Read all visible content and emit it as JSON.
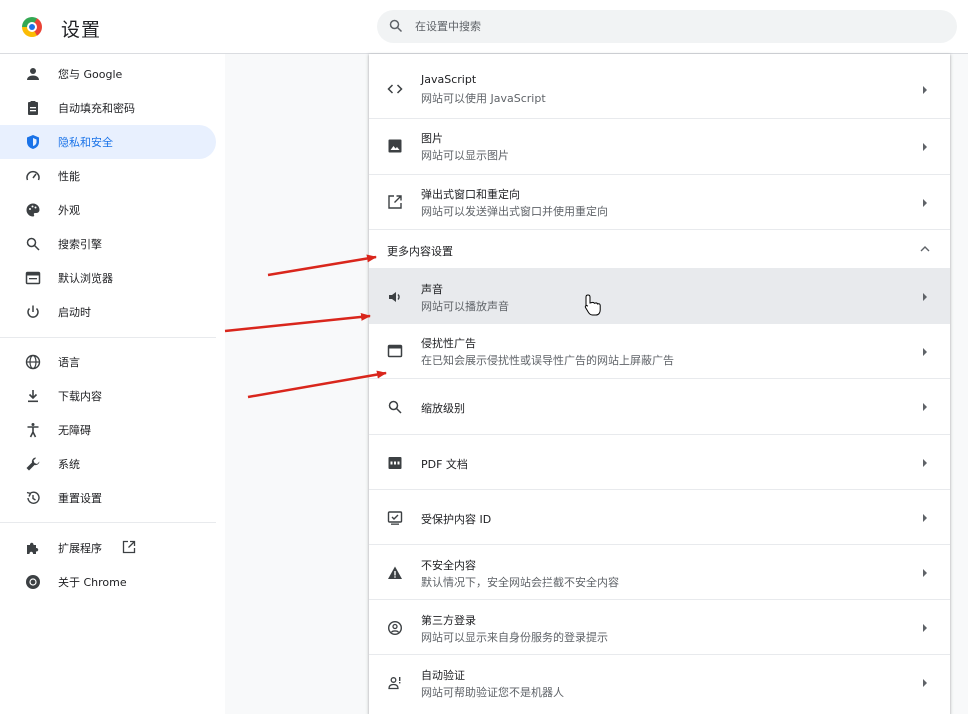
{
  "app": {
    "title": "设置",
    "icon": "chrome-logo"
  },
  "search": {
    "placeholder": "在设置中搜索",
    "value": "",
    "icon": "search-icon"
  },
  "sidebar": {
    "items": [
      {
        "label": "您与 Google",
        "icon": "person-icon",
        "active": false
      },
      {
        "label": "自动填充和密码",
        "icon": "clipboard-icon",
        "active": false
      },
      {
        "label": "隐私和安全",
        "icon": "shield-icon",
        "active": true
      },
      {
        "label": "性能",
        "icon": "speedometer-icon",
        "active": false
      },
      {
        "label": "外观",
        "icon": "palette-icon",
        "active": false
      },
      {
        "label": "搜索引擎",
        "icon": "search-icon",
        "active": false
      },
      {
        "label": "默认浏览器",
        "icon": "browser-icon",
        "active": false
      },
      {
        "label": "启动时",
        "icon": "power-icon",
        "active": false
      },
      {
        "label": "语言",
        "icon": "globe-icon",
        "active": false
      },
      {
        "label": "下载内容",
        "icon": "download-icon",
        "active": false
      },
      {
        "label": "无障碍",
        "icon": "accessibility-icon",
        "active": false
      },
      {
        "label": "系统",
        "icon": "wrench-icon",
        "active": false
      },
      {
        "label": "重置设置",
        "icon": "history-icon",
        "active": false
      },
      {
        "label": "扩展程序",
        "icon": "puzzle-icon",
        "active": false,
        "external": "open-in-new-icon"
      },
      {
        "label": "关于 Chrome",
        "icon": "chrome-icon",
        "active": false
      }
    ]
  },
  "content": {
    "rows_top": [
      {
        "title": "JavaScript",
        "subtitle": "网站可以使用 JavaScript",
        "icon": "code-icon"
      },
      {
        "title": "图片",
        "subtitle": "网站可以显示图片",
        "icon": "image-icon"
      },
      {
        "title": "弹出式窗口和重定向",
        "subtitle": "网站可以发送弹出式窗口并使用重定向",
        "icon": "open-in-new-icon"
      }
    ],
    "more_section": {
      "title": "更多内容设置",
      "expanded": true
    },
    "rows_more": [
      {
        "title": "声音",
        "subtitle": "网站可以播放声音",
        "icon": "speaker-icon",
        "hovered": true
      },
      {
        "title": "侵扰性广告",
        "subtitle": "在已知会展示侵扰性或误导性广告的网站上屏蔽广告",
        "icon": "ad-icon"
      },
      {
        "title": "缩放级别",
        "subtitle": "",
        "icon": "zoom-icon"
      },
      {
        "title": "PDF 文档",
        "subtitle": "",
        "icon": "pdf-icon"
      },
      {
        "title": "受保护内容 ID",
        "subtitle": "",
        "icon": "protected-content-icon"
      },
      {
        "title": "不安全内容",
        "subtitle": "默认情况下，安全网站会拦截不安全内容",
        "icon": "warning-icon"
      },
      {
        "title": "第三方登录",
        "subtitle": "网站可以显示来自身份服务的登录提示",
        "icon": "account-circle-icon"
      },
      {
        "title": "自动验证",
        "subtitle": "网站可帮助验证您不是机器人",
        "icon": "verified-user-icon"
      }
    ]
  },
  "colors": {
    "accent": "#1a73e8",
    "active_bg": "#e8f0fe",
    "hover_bg": "#e8eaed",
    "annotation_arrow": "#d9261c"
  }
}
